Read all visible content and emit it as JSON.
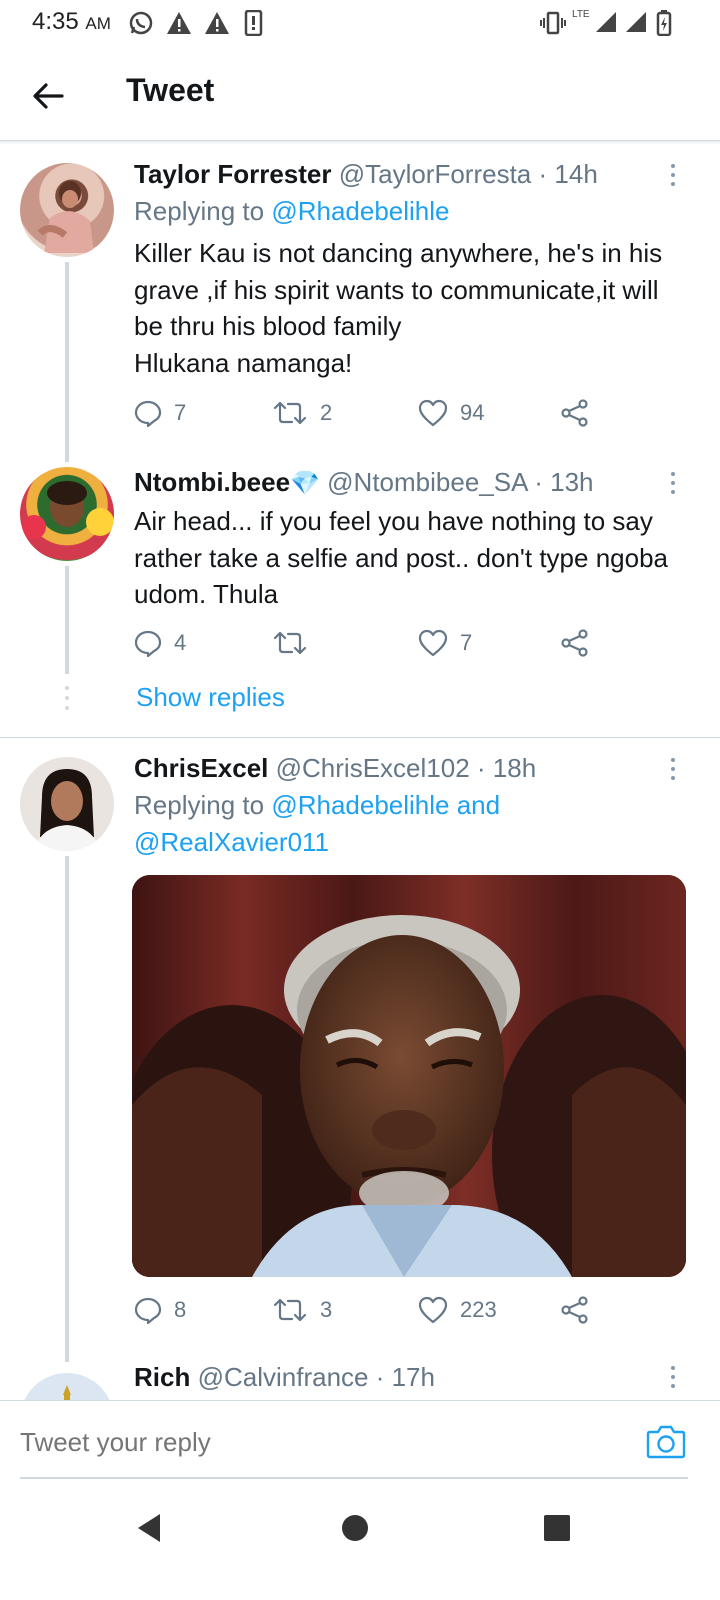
{
  "status": {
    "time": "4:35",
    "ampm": "AM",
    "network": "LTE"
  },
  "header": {
    "title": "Tweet"
  },
  "tweets": [
    {
      "name": "Taylor Forrester",
      "handle": "@TaylorForresta",
      "time": "· 14h",
      "replying_prefix": "Replying to ",
      "replying_to": "@Rhadebelihle",
      "body": "Killer Kau is not dancing anywhere, he's in his grave ,if his spirit wants to communicate,it will be thru his blood family\nHlukana namanga!",
      "replies": "7",
      "retweets": "2",
      "likes": "94"
    },
    {
      "name": "Ntombi.beee",
      "badge": "💎",
      "handle": "@Ntombibee_SA",
      "time": "· 13h",
      "body": "Air head... if you feel you have nothing to say rather take a selfie and post.. don't type ngoba udom. Thula",
      "replies": "4",
      "retweets": "",
      "likes": "7"
    },
    {
      "name": "ChrisExcel",
      "handle": "@ChrisExcel102",
      "time": "· 18h",
      "replying_prefix": "Replying to ",
      "replying_to": "@Rhadebelihle and",
      "replying_to_2": "@RealXavier011",
      "replies": "8",
      "retweets": "3",
      "likes": "223"
    },
    {
      "name": "Rich",
      "handle": "@Calvinfrance",
      "time": "· 17h"
    }
  ],
  "show_replies": "Show replies",
  "composer": {
    "placeholder": "Tweet your reply"
  },
  "colors": {
    "accent": "#1da1f2",
    "muted": "#657786",
    "text": "#14171a",
    "divider": "#cfd9de"
  },
  "icons": {
    "back": "arrow-left-icon",
    "reply": "comment-icon",
    "retweet": "retweet-icon",
    "like": "heart-icon",
    "share": "share-icon",
    "more": "more-vertical-icon",
    "camera": "camera-icon"
  }
}
